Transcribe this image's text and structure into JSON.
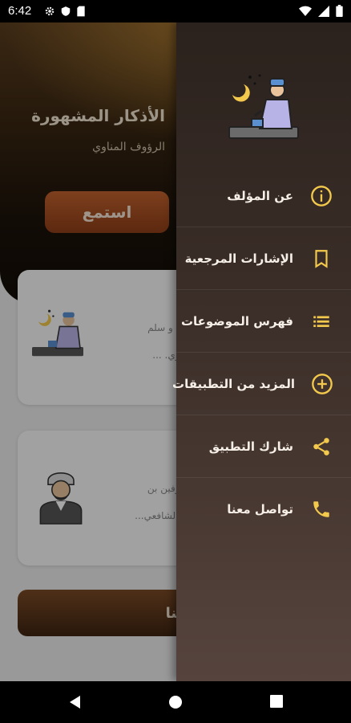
{
  "status_bar": {
    "time": "6:42",
    "icons": [
      "gear-icon",
      "shield-icon",
      "sd-card-icon",
      "wifi-icon",
      "signal-icon",
      "battery-icon"
    ]
  },
  "background": {
    "title": "الأذكار المشهورة",
    "subtitle": "الرؤوف المناوي",
    "listen_label": "استمع",
    "card1_lines": [
      "الله عليه و سلم",
      "ف المناوي. ..."
    ],
    "card2_lines": [
      "ماع العارفين بن",
      "لقاهري الشافعي..."
    ],
    "contact_label": "معنا"
  },
  "drawer": {
    "items": [
      {
        "label": "عن المؤلف",
        "icon": "info-icon"
      },
      {
        "label": "الإشارات المرجعية",
        "icon": "bookmark-icon"
      },
      {
        "label": "فهرس الموضوعات",
        "icon": "list-icon"
      },
      {
        "label": "المزيد من التطبيقات",
        "icon": "add-circle-icon"
      },
      {
        "label": "شارك التطبيق",
        "icon": "share-icon"
      },
      {
        "label": "تواصل معنا",
        "icon": "phone-icon"
      }
    ]
  },
  "colors": {
    "accent": "#f2c94c",
    "drawer_top": "#2b221d",
    "drawer_bottom": "#56433d"
  }
}
